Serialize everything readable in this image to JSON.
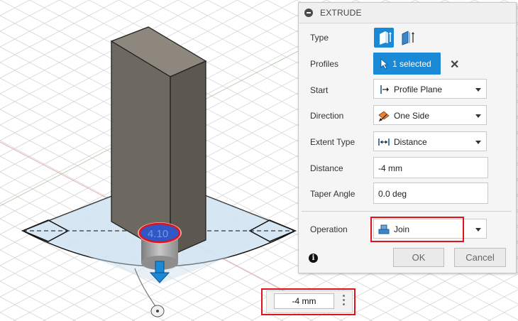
{
  "panel": {
    "title": "EXTRUDE",
    "rows": {
      "type": {
        "label": "Type"
      },
      "profiles": {
        "label": "Profiles",
        "value": "1 selected"
      },
      "start": {
        "label": "Start",
        "value": "Profile Plane"
      },
      "direction": {
        "label": "Direction",
        "value": "One Side"
      },
      "extent_type": {
        "label": "Extent Type",
        "value": "Distance"
      },
      "distance": {
        "label": "Distance",
        "value": "-4 mm"
      },
      "taper_angle": {
        "label": "Taper Angle",
        "value": "0.0 deg"
      },
      "operation": {
        "label": "Operation",
        "value": "Join"
      }
    },
    "ok_label": "OK",
    "cancel_label": "Cancel",
    "info_glyph": "i"
  },
  "hud": {
    "value": "-4 mm"
  },
  "viewport": {
    "dimension_label": "4.10"
  },
  "colors": {
    "accent_blue": "#1b8ad6",
    "highlight_red": "#e0121b",
    "body_gray": "#6e6960",
    "profile_fill": "#2f57c6"
  },
  "icons": {
    "collapse": "collapse-icon",
    "solid_type": "solid-extrude-icon",
    "surface_type": "surface-extrude-icon",
    "select_cursor": "cursor-icon",
    "clear": "close-icon",
    "profile_plane": "profile-plane-icon",
    "one_side": "one-side-icon",
    "distance": "distance-icon",
    "join": "join-icon",
    "info": "info-icon",
    "grip": "grip-dots-icon"
  }
}
